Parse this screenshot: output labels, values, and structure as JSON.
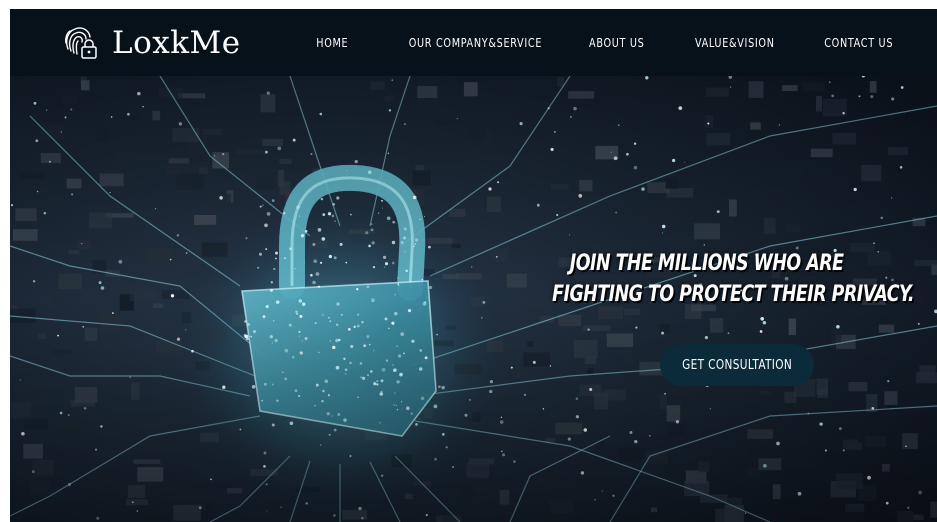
{
  "brand": {
    "name": "LoxkMe",
    "icon": "fingerprint-lock-icon"
  },
  "nav": {
    "items": [
      {
        "label": "HOME"
      },
      {
        "label": "OUR COMPANY&SERVICE"
      },
      {
        "label": "ABOUT US"
      },
      {
        "label": "VALUE&VISION"
      },
      {
        "label": "CONTACT US"
      }
    ]
  },
  "hero": {
    "headline_line1": "JOIN THE MILLIONS WHO ARE",
    "headline_line2": "FIGHTING TO PROTECT THEIR PRIVACY.",
    "cta_label": "GET CONSULTATION",
    "image": "glowing-padlock-circuit-board-image"
  },
  "colors": {
    "navbar_bg": "#07111a",
    "cta_bg": "#0b2a3a",
    "glow": "#7fe4f2"
  }
}
